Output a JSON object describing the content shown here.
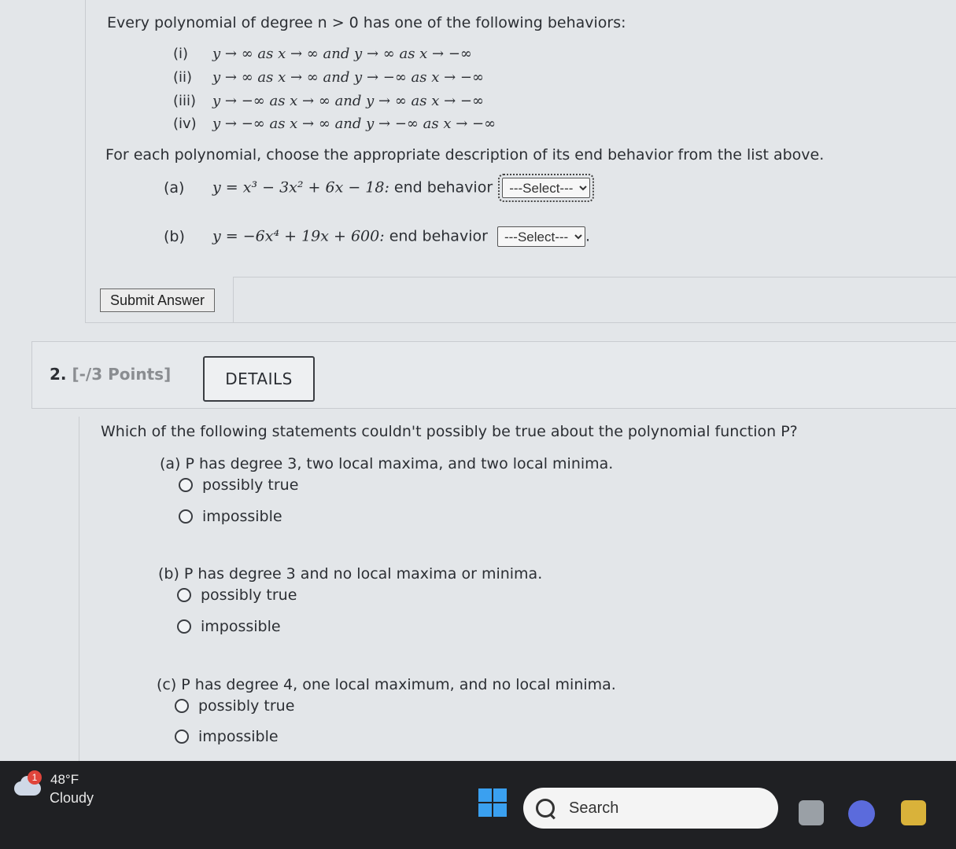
{
  "question1": {
    "intro": "Every polynomial of degree n > 0 has one of the following behaviors:",
    "behaviors": [
      {
        "num": "(i)",
        "text": "y → ∞ as x → ∞ and y → ∞ as x → −∞"
      },
      {
        "num": "(ii)",
        "text": "y → ∞ as x → ∞ and y → −∞ as x → −∞"
      },
      {
        "num": "(iii)",
        "text": "y → −∞ as x → ∞ and y → ∞ as x → −∞"
      },
      {
        "num": "(iv)",
        "text": "y → −∞ as x → ∞ and y → −∞ as x → −∞"
      }
    ],
    "prompt": "For each polynomial, choose the appropriate description of its end behavior from the list above.",
    "parts": [
      {
        "label": "(a)",
        "equation": "y = x³ − 3x² + 6x − 18:",
        "suffix": "end behavior",
        "select_value": "---Select---"
      },
      {
        "label": "(b)",
        "equation": "y = −6x⁴ + 19x + 600:",
        "suffix": "end behavior",
        "select_value": "---Select---",
        "end": "."
      }
    ],
    "submit_label": "Submit Answer"
  },
  "question2": {
    "number": "2.",
    "points": "[-/3 Points]",
    "details_label": "DETAILS",
    "text": "Which of the following statements couldn't possibly be true about the polynomial function P?",
    "parts": [
      {
        "label": "(a) P has degree 3, two local maxima, and two local minima.",
        "options": [
          "possibly true",
          "impossible"
        ]
      },
      {
        "label": "(b) P has degree 3 and no local maxima or minima.",
        "options": [
          "possibly true",
          "impossible"
        ]
      },
      {
        "label": "(c) P has degree 4, one local maximum, and no local minima.",
        "options": [
          "possibly true",
          "impossible"
        ]
      }
    ]
  },
  "taskbar": {
    "notification_count": "1",
    "temperature": "48°F",
    "condition": "Cloudy",
    "search_label": "Search"
  }
}
